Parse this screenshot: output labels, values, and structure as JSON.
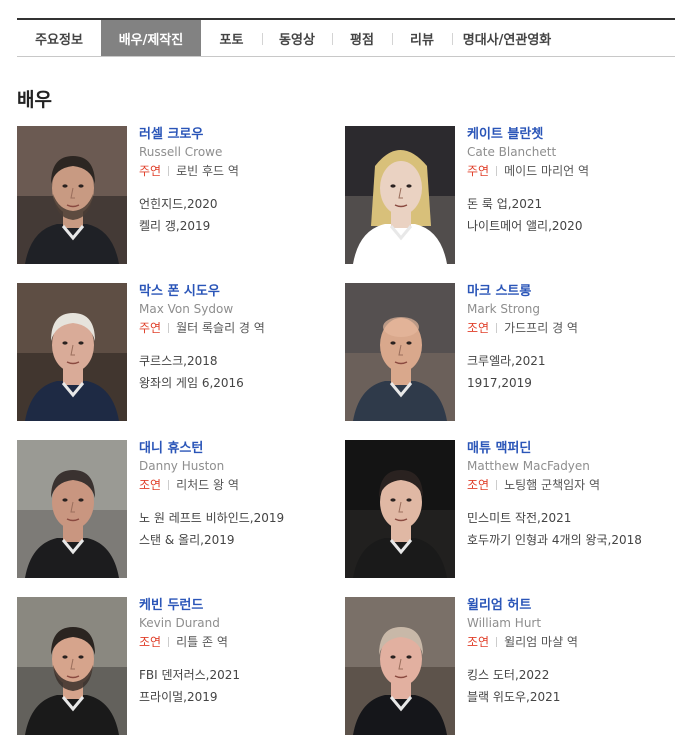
{
  "tabs": [
    {
      "label": "주요정보"
    },
    {
      "label": "배우/제작진"
    },
    {
      "label": "포토"
    },
    {
      "label": "동영상"
    },
    {
      "label": "평점"
    },
    {
      "label": "리뷰"
    },
    {
      "label": "명대사/연관영화"
    }
  ],
  "active_tab": "배우/제작진",
  "section_title": "배우",
  "cast": [
    {
      "name_ko": "러셀 크로우",
      "name_en": "Russell Crowe",
      "role_type": "주연",
      "role": "로빈 후드 역",
      "works": [
        "언힌지드,2020",
        "켈리 갱,2019"
      ]
    },
    {
      "name_ko": "케이트 블란쳇",
      "name_en": "Cate Blanchett",
      "role_type": "주연",
      "role": "메이드 마리언 역",
      "works": [
        "돈 룩 업,2021",
        "나이트메어 앨리,2020"
      ]
    },
    {
      "name_ko": "막스 폰 시도우",
      "name_en": "Max Von Sydow",
      "role_type": "주연",
      "role": "월터 록슬리 경 역",
      "works": [
        "쿠르스크,2018",
        "왕좌의 게임 6,2016"
      ]
    },
    {
      "name_ko": "마크 스트롱",
      "name_en": "Mark Strong",
      "role_type": "조연",
      "role": "가드프리 경 역",
      "works": [
        "크루엘라,2021",
        "1917,2019"
      ]
    },
    {
      "name_ko": "대니 휴스턴",
      "name_en": "Danny Huston",
      "role_type": "조연",
      "role": "리처드 왕 역",
      "works": [
        "노 원 레프트 비하인드,2019",
        "스탠 & 올리,2019"
      ]
    },
    {
      "name_ko": "매튜 맥퍼딘",
      "name_en": "Matthew MacFadyen",
      "role_type": "조연",
      "role": "노팅햄 군책임자 역",
      "works": [
        "민스미트 작전,2021",
        "호두까기 인형과 4개의 왕국,2018"
      ]
    },
    {
      "name_ko": "케빈 두런드",
      "name_en": "Kevin Durand",
      "role_type": "조연",
      "role": "리틀 존 역",
      "works": [
        "FBI 덴저러스,2021",
        "프라이멀,2019"
      ]
    },
    {
      "name_ko": "윌리엄 허트",
      "name_en": "William Hurt",
      "role_type": "조연",
      "role": "윌리엄 마샬 역",
      "works": [
        "킹스 도터,2022",
        "블랙 위도우,2021"
      ]
    }
  ],
  "colors": {
    "active_tab_bg": "#828282",
    "name_link": "#2a55b8",
    "role_type": "#e0402b"
  }
}
